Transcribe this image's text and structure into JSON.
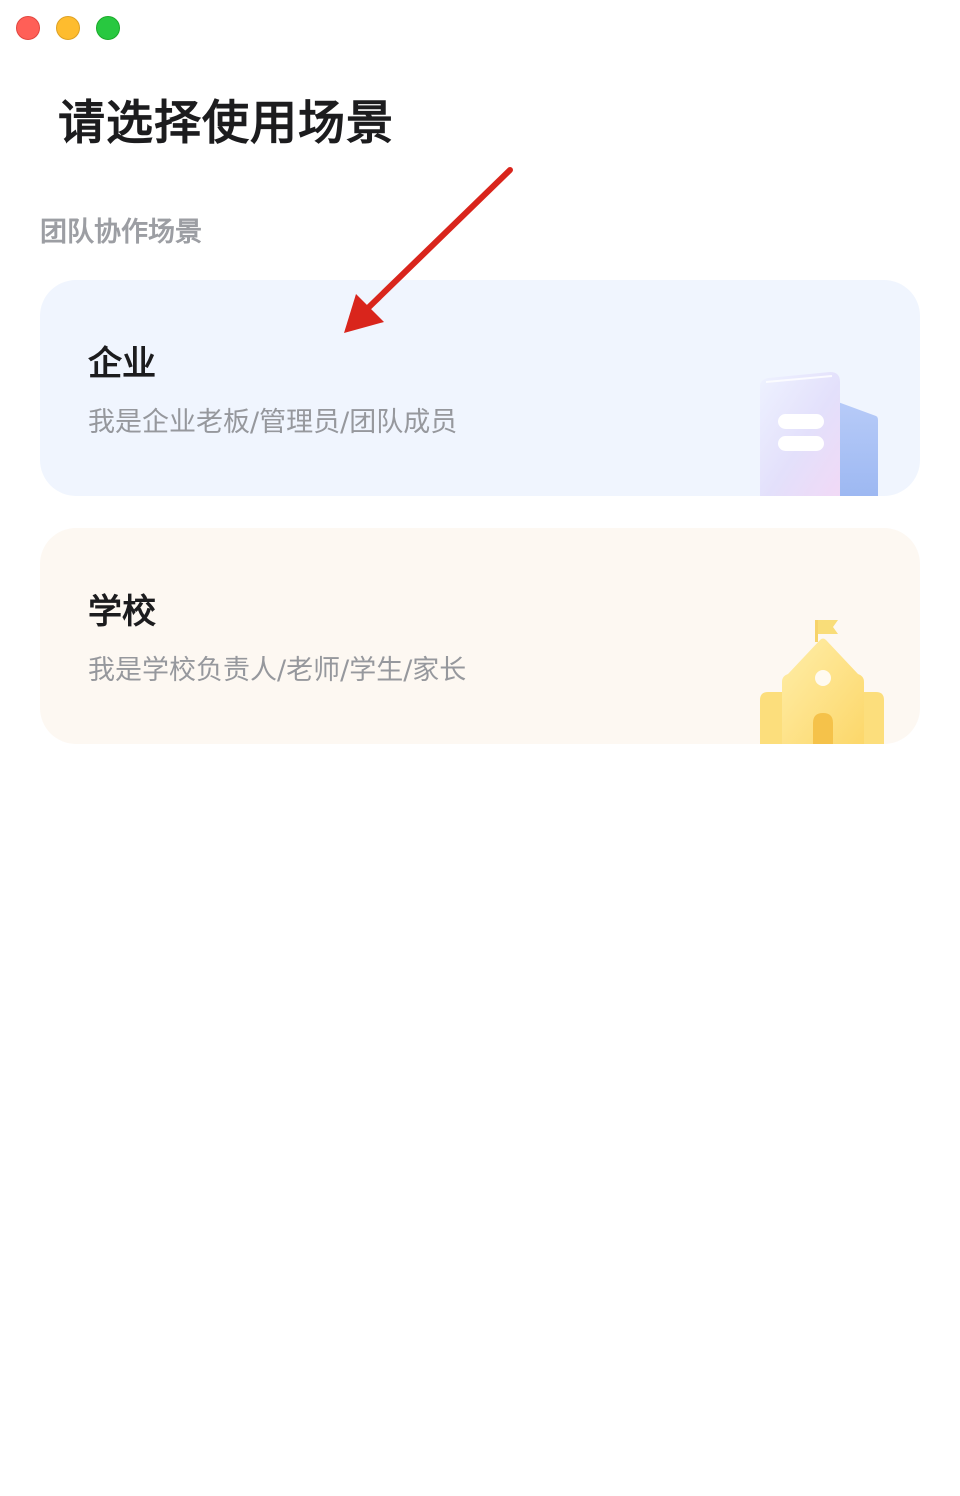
{
  "window": {
    "controls": [
      "close",
      "minimize",
      "maximize"
    ]
  },
  "page": {
    "title": "请选择使用场景"
  },
  "section": {
    "label": "团队协作场景"
  },
  "cards": [
    {
      "title": "企业",
      "description": "我是企业老板/管理员/团队成员",
      "icon": "office-building-icon",
      "bg_color": "#f0f5fe"
    },
    {
      "title": "学校",
      "description": "我是学校负责人/老师/学生/家长",
      "icon": "school-building-icon",
      "bg_color": "#fdf8f2"
    }
  ],
  "annotation": {
    "type": "arrow",
    "color": "#d9251c",
    "points_to": "enterprise-card"
  }
}
